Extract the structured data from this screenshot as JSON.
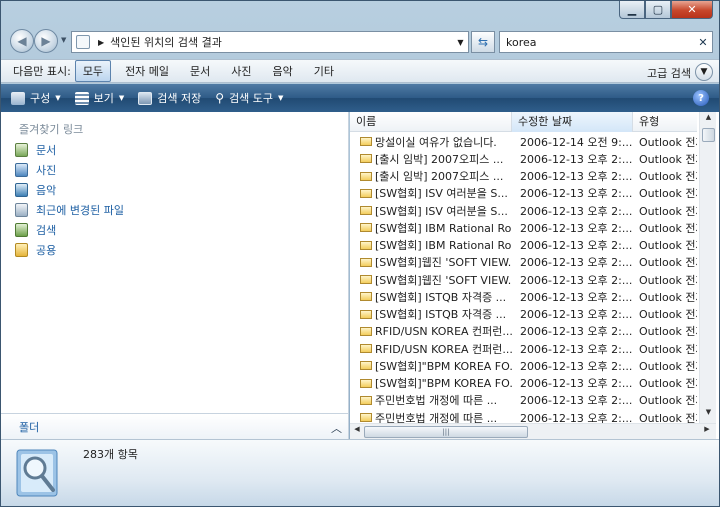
{
  "address": {
    "path": "색인된 위치의 검색 결과"
  },
  "search": {
    "value": "korea"
  },
  "filter": {
    "label": "다음만 표시:",
    "items": [
      "모두",
      "전자 메일",
      "문서",
      "사진",
      "음악",
      "기타"
    ],
    "active": "모두",
    "advanced": "고급 검색"
  },
  "toolbar": {
    "organize": "구성",
    "views": "보기",
    "save_search": "검색 저장",
    "search_tools": "검색 도구"
  },
  "nav": {
    "header": "즐겨찾기 링크",
    "links": [
      "문서",
      "사진",
      "음악",
      "최근에 변경된 파일",
      "검색",
      "공용"
    ],
    "folders": "폴더"
  },
  "columns": {
    "name": "이름",
    "date": "수정한 날짜",
    "type": "유형"
  },
  "rows": [
    {
      "name": "망설이실 여유가 없습니다.",
      "date": "2006-12-14 오전 9:...",
      "type": "Outlook 전자"
    },
    {
      "name": "[출시 임박] 2007오피스 ...",
      "date": "2006-12-13 오후 2:...",
      "type": "Outlook 전자"
    },
    {
      "name": "[출시 임박] 2007오피스 ...",
      "date": "2006-12-13 오후 2:...",
      "type": "Outlook 전자"
    },
    {
      "name": "[SW협회] ISV 여러분을 S...",
      "date": "2006-12-13 오후 2:...",
      "type": "Outlook 전자"
    },
    {
      "name": "[SW협회] ISV 여러분을 S...",
      "date": "2006-12-13 오후 2:...",
      "type": "Outlook 전자"
    },
    {
      "name": "[SW협회] IBM Rational Ro...",
      "date": "2006-12-13 오후 2:...",
      "type": "Outlook 전자"
    },
    {
      "name": "[SW협회] IBM Rational Ro...",
      "date": "2006-12-13 오후 2:...",
      "type": "Outlook 전자"
    },
    {
      "name": "[SW협회]웹진 'SOFT VIEW...",
      "date": "2006-12-13 오후 2:...",
      "type": "Outlook 전자"
    },
    {
      "name": "[SW협회]웹진 'SOFT VIEW...",
      "date": "2006-12-13 오후 2:...",
      "type": "Outlook 전자"
    },
    {
      "name": "[SW협회] ISTQB 자격증 ...",
      "date": "2006-12-13 오후 2:...",
      "type": "Outlook 전자"
    },
    {
      "name": "[SW협회] ISTQB 자격증 ...",
      "date": "2006-12-13 오후 2:...",
      "type": "Outlook 전자"
    },
    {
      "name": "RFID/USN KOREA 컨퍼런...",
      "date": "2006-12-13 오후 2:...",
      "type": "Outlook 전자"
    },
    {
      "name": "RFID/USN KOREA 컨퍼런...",
      "date": "2006-12-13 오후 2:...",
      "type": "Outlook 전자"
    },
    {
      "name": "[SW협회]\"BPM KOREA FO...",
      "date": "2006-12-13 오후 2:...",
      "type": "Outlook 전자"
    },
    {
      "name": "[SW협회]\"BPM KOREA FO...",
      "date": "2006-12-13 오후 2:...",
      "type": "Outlook 전자"
    },
    {
      "name": "주민번호법 개정에 따른 ...",
      "date": "2006-12-13 오후 2:...",
      "type": "Outlook 전자"
    },
    {
      "name": "주민번호법 개정에 따른 ...",
      "date": "2006-12-13 오후 2:...",
      "type": "Outlook 전자"
    }
  ],
  "details": {
    "count": "283개 항목"
  },
  "colors": {
    "toolbar": "#2e5b87",
    "link": "#1d5fa3",
    "close": "#c7472c"
  }
}
